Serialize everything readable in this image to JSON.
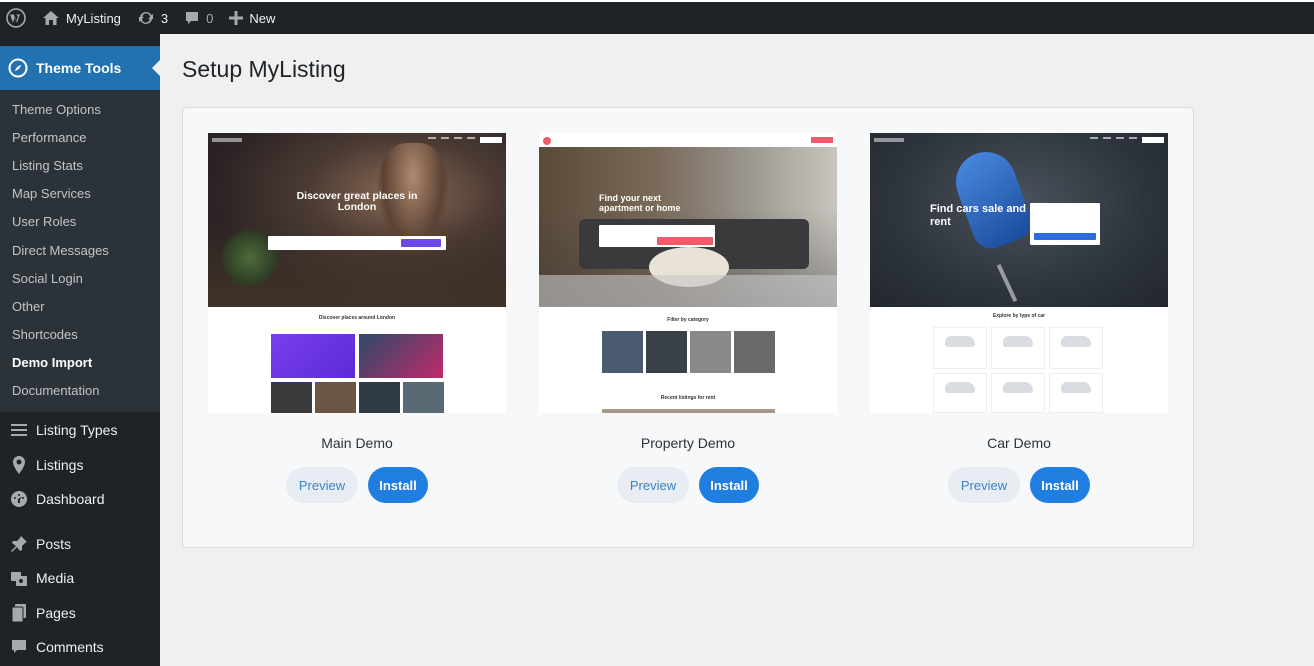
{
  "admin_bar": {
    "site_name": "MyListing",
    "updates_count": "3",
    "comments_count": "0",
    "new_label": "New"
  },
  "sidebar": {
    "current_menu": "Theme Tools",
    "submenu": [
      {
        "label": "Theme Options"
      },
      {
        "label": "Performance"
      },
      {
        "label": "Listing Stats"
      },
      {
        "label": "Map Services"
      },
      {
        "label": "User Roles"
      },
      {
        "label": "Direct Messages"
      },
      {
        "label": "Social Login"
      },
      {
        "label": "Other"
      },
      {
        "label": "Shortcodes"
      },
      {
        "label": "Demo Import",
        "active": true
      },
      {
        "label": "Documentation"
      }
    ],
    "menu": [
      {
        "label": "Listing Types",
        "icon": "list-icon"
      },
      {
        "label": "Listings",
        "icon": "location-pin-icon"
      },
      {
        "label": "Dashboard",
        "icon": "dashboard-icon"
      },
      {
        "label": "Posts",
        "icon": "pushpin-icon"
      },
      {
        "label": "Media",
        "icon": "media-icon"
      },
      {
        "label": "Pages",
        "icon": "pages-icon"
      },
      {
        "label": "Comments",
        "icon": "comment-icon"
      }
    ]
  },
  "main": {
    "title": "Setup MyListing",
    "demos": [
      {
        "name": "Main Demo",
        "preview_label": "Preview",
        "install_label": "Install",
        "hero_title": "Discover great places in London",
        "section_title": "Discover places around London"
      },
      {
        "name": "Property Demo",
        "preview_label": "Preview",
        "install_label": "Install",
        "hero_title": "Find your next apartment or home",
        "section_title": "Filter by category",
        "section_title_2": "Recent listings for rent"
      },
      {
        "name": "Car Demo",
        "preview_label": "Preview",
        "install_label": "Install",
        "hero_title": "Find cars sale and rent",
        "section_title": "Explore by type of car"
      }
    ]
  },
  "colors": {
    "admin_bar_bg": "#1d2327",
    "menu_current_bg": "#2271b1",
    "install_button": "#1f7ee0",
    "preview_button_bg": "#e8edf3"
  }
}
